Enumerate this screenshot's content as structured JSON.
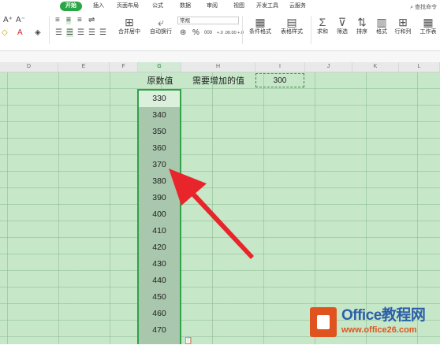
{
  "ribbon": {
    "tabs": [
      "开始",
      "插入",
      "页面布局",
      "公式",
      "数据",
      "审阅",
      "视图",
      "开发工具",
      "云服务"
    ],
    "active_tab": "开始",
    "search_label": "查找命令",
    "number_format": "常规",
    "buttons": {
      "merge_center": "合并居中",
      "wrap_text": "自动换行",
      "conditional_format": "条件格式",
      "table_style": "表格样式",
      "sum": "求和",
      "filter": "筛选",
      "sort": "排序",
      "format": "格式",
      "rows_cols": "行和列",
      "worksheet": "工作表"
    },
    "percent_symbol": "%",
    "thousands_symbol": "000",
    "inc_decimal": "+.0 .00",
    "dec_decimal": ".00 +.0"
  },
  "columns": [
    "D",
    "E",
    "F",
    "G",
    "H",
    "I",
    "J",
    "K",
    "L"
  ],
  "selected_column": "G",
  "cells": {
    "g_header": "原数值",
    "h_header": "需要增加的值",
    "i_value": "300",
    "g_values": [
      "330",
      "340",
      "350",
      "360",
      "370",
      "380",
      "390",
      "400",
      "410",
      "420",
      "430",
      "440",
      "450",
      "460",
      "470"
    ]
  },
  "watermark": {
    "brand": "Office教程网",
    "url": "www.office26.com"
  },
  "colors": {
    "accent": "#29a745",
    "sheet_bg": "#c6e8c9",
    "selection_border": "#31a14a",
    "arrow": "#e8252b",
    "logo_orange": "#e0531f",
    "logo_blue": "#2d5fa8"
  }
}
